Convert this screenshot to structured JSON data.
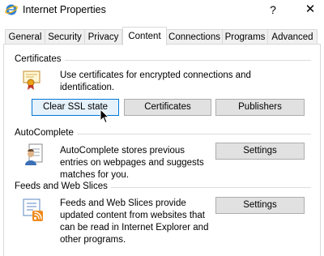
{
  "window": {
    "title": "Internet Properties",
    "help_label": "?",
    "close_label": "✕"
  },
  "tabs": [
    {
      "label": "General",
      "active": false
    },
    {
      "label": "Security",
      "active": false
    },
    {
      "label": "Privacy",
      "active": false
    },
    {
      "label": "Content",
      "active": true
    },
    {
      "label": "Connections",
      "active": false
    },
    {
      "label": "Programs",
      "active": false
    },
    {
      "label": "Advanced",
      "active": false
    }
  ],
  "certificates": {
    "heading": "Certificates",
    "description": "Use certificates for encrypted connections and identification.",
    "icon": "certificate-icon",
    "buttons": {
      "clear_ssl": "Clear SSL state",
      "certificates": "Certificates",
      "publishers": "Publishers"
    }
  },
  "autocomplete": {
    "heading": "AutoComplete",
    "description": "AutoComplete stores previous entries on webpages and suggests matches for you.",
    "icon": "user-form-icon",
    "settings_label": "Settings"
  },
  "feeds": {
    "heading": "Feeds and Web Slices",
    "description": "Feeds and Web Slices provide updated content from websites that can be read in Internet Explorer and other programs.",
    "icon": "rss-feed-icon",
    "settings_label": "Settings"
  }
}
